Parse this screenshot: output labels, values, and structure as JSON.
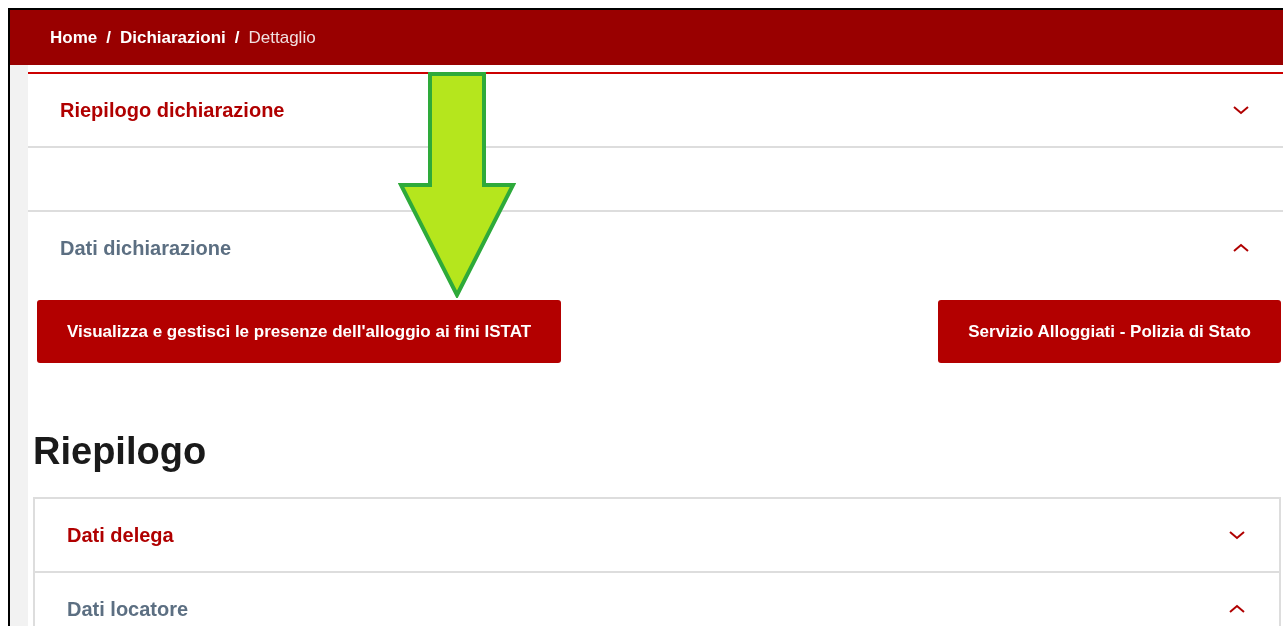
{
  "breadcrumb_separator": "/",
  "breadcrumb": [
    {
      "label": "Home",
      "current": false
    },
    {
      "label": "Dichiarazioni",
      "current": false
    },
    {
      "label": "Dettaglio",
      "current": true
    }
  ],
  "sections": [
    {
      "title": "Riepilogo dichiarazione",
      "expanded": false
    },
    {
      "title": "Dati dichiarazione",
      "expanded": true
    }
  ],
  "buttons": [
    "Visualizza e gestisci le presenze dell'alloggio ai fini ISTAT",
    "Servizio Alloggiati - Polizia di Stato"
  ],
  "summary": {
    "heading": "Riepilogo",
    "sections": [
      {
        "title": "Dati delega",
        "expanded": false
      },
      {
        "title": "Dati locatore",
        "expanded": true
      }
    ]
  }
}
